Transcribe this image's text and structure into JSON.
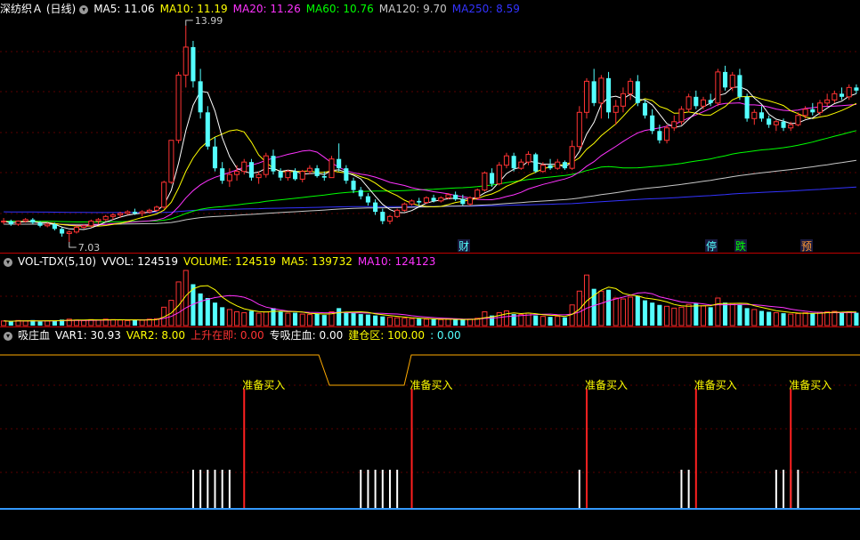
{
  "colors": {
    "up": "#ff3333",
    "down": "#54ffff",
    "ma5": "#ffffff",
    "ma10": "#ffff00",
    "ma20": "#ff33ff",
    "ma60": "#00ff00",
    "ma120": "#c8c8c8",
    "ma250": "#3333ff",
    "grid": "#5a0000",
    "separator": "#c00000"
  },
  "main": {
    "stock_name": "深纺织Ａ (日线)",
    "legend": [
      {
        "text": "MA5: 11.06",
        "color": "#ffffff"
      },
      {
        "text": "MA10: 11.19",
        "color": "#ffff00"
      },
      {
        "text": "MA20: 11.26",
        "color": "#ff33ff"
      },
      {
        "text": "MA60: 10.76",
        "color": "#00ff00"
      },
      {
        "text": "MA120: 9.70",
        "color": "#c8c8c8"
      },
      {
        "text": "MA250: 8.59",
        "color": "#3333ff"
      }
    ],
    "high_label": "13.99",
    "low_label": "7.03",
    "event_marks": [
      {
        "text": "财",
        "color": "#54ffff"
      },
      {
        "text": "停",
        "color": "#54ffff"
      },
      {
        "text": "跌",
        "color": "#00ff00"
      },
      {
        "text": "预",
        "color": "#ff9933"
      }
    ]
  },
  "volume": {
    "indicator": "VOL-TDX(5,10)",
    "legend": [
      {
        "text": "VVOL: 124519",
        "color": "#ffffff"
      },
      {
        "text": "VOLUME: 124519",
        "color": "#ffff00"
      },
      {
        "text": "MA5: 139732",
        "color": "#ffff00"
      },
      {
        "text": "MA10: 124123",
        "color": "#ff33ff"
      }
    ]
  },
  "indicator": {
    "name": "吸庄血",
    "legend": [
      {
        "text": "VAR1: 30.93",
        "color": "#ffffff"
      },
      {
        "text": "VAR2: 8.00",
        "color": "#ffff00"
      },
      {
        "text": "上升在即: 0.00",
        "color": "#ff3333"
      },
      {
        "text": "专吸庄血: 0.00",
        "color": "#ffffff"
      },
      {
        "text": "建仓区: 100.00",
        "color": "#ffff00"
      },
      {
        "text": ": 0.00",
        "color": "#54ffff"
      }
    ],
    "signal_label": "准备买入"
  },
  "chart_data": [
    {
      "type": "candlestick",
      "title": "深纺织Ａ (日线)",
      "price_range": [
        7.03,
        13.99
      ],
      "high": 13.99,
      "low": 7.03,
      "ohlc": [
        [
          7.7,
          7.8,
          7.6,
          7.7
        ],
        [
          7.7,
          7.75,
          7.55,
          7.6
        ],
        [
          7.6,
          7.72,
          7.55,
          7.7
        ],
        [
          7.7,
          7.8,
          7.65,
          7.75
        ],
        [
          7.75,
          7.8,
          7.6,
          7.65
        ],
        [
          7.65,
          7.7,
          7.5,
          7.55
        ],
        [
          7.55,
          7.65,
          7.5,
          7.6
        ],
        [
          7.6,
          7.65,
          7.4,
          7.45
        ],
        [
          7.45,
          7.5,
          7.2,
          7.3
        ],
        [
          7.3,
          7.4,
          7.03,
          7.35
        ],
        [
          7.35,
          7.55,
          7.3,
          7.5
        ],
        [
          7.5,
          7.6,
          7.45,
          7.55
        ],
        [
          7.55,
          7.75,
          7.5,
          7.7
        ],
        [
          7.7,
          7.8,
          7.6,
          7.75
        ],
        [
          7.75,
          7.9,
          7.7,
          7.85
        ],
        [
          7.85,
          7.95,
          7.75,
          7.9
        ],
        [
          7.9,
          8.0,
          7.8,
          7.95
        ],
        [
          7.95,
          8.05,
          7.9,
          8.0
        ],
        [
          8.0,
          8.1,
          7.9,
          7.95
        ],
        [
          7.95,
          8.05,
          7.85,
          8.0
        ],
        [
          8.0,
          8.1,
          7.95,
          8.05
        ],
        [
          8.05,
          8.2,
          8.0,
          8.15
        ],
        [
          8.15,
          9.0,
          8.1,
          8.95
        ],
        [
          8.95,
          10.3,
          8.9,
          10.3
        ],
        [
          10.3,
          12.5,
          10.2,
          12.4
        ],
        [
          12.4,
          13.99,
          12.0,
          13.3
        ],
        [
          13.3,
          13.5,
          12.0,
          12.2
        ],
        [
          12.2,
          12.6,
          11.0,
          11.2
        ],
        [
          11.2,
          11.4,
          10.0,
          10.1
        ],
        [
          10.1,
          10.4,
          9.3,
          9.4
        ],
        [
          9.4,
          9.6,
          8.9,
          9.0
        ],
        [
          9.0,
          9.4,
          8.8,
          9.2
        ],
        [
          9.2,
          9.5,
          9.0,
          9.3
        ],
        [
          9.3,
          9.7,
          9.2,
          9.6
        ],
        [
          9.6,
          9.7,
          9.0,
          9.1
        ],
        [
          9.1,
          9.3,
          8.9,
          9.2
        ],
        [
          9.2,
          9.9,
          9.1,
          9.8
        ],
        [
          9.8,
          10.0,
          9.2,
          9.3
        ],
        [
          9.3,
          9.4,
          9.0,
          9.1
        ],
        [
          9.1,
          9.35,
          9.0,
          9.3
        ],
        [
          9.3,
          9.4,
          9.0,
          9.05
        ],
        [
          9.05,
          9.35,
          8.95,
          9.3
        ],
        [
          9.3,
          9.5,
          9.2,
          9.4
        ],
        [
          9.4,
          9.5,
          9.1,
          9.15
        ],
        [
          9.15,
          9.3,
          9.0,
          9.1
        ],
        [
          9.1,
          9.8,
          9.1,
          9.7
        ],
        [
          9.7,
          10.2,
          9.3,
          9.4
        ],
        [
          9.4,
          9.5,
          8.9,
          9.0
        ],
        [
          9.0,
          9.1,
          8.6,
          8.7
        ],
        [
          8.7,
          8.8,
          8.4,
          8.5
        ],
        [
          8.5,
          8.6,
          8.2,
          8.3
        ],
        [
          8.3,
          8.4,
          7.9,
          8.0
        ],
        [
          8.0,
          8.1,
          7.6,
          7.7
        ],
        [
          7.7,
          7.9,
          7.6,
          7.85
        ],
        [
          7.85,
          8.1,
          7.8,
          8.05
        ],
        [
          8.05,
          8.3,
          8.0,
          8.25
        ],
        [
          8.25,
          8.4,
          8.2,
          8.35
        ],
        [
          8.35,
          8.45,
          8.2,
          8.3
        ],
        [
          8.3,
          8.5,
          8.25,
          8.45
        ],
        [
          8.45,
          8.55,
          8.3,
          8.35
        ],
        [
          8.35,
          8.5,
          8.3,
          8.45
        ],
        [
          8.45,
          8.6,
          8.4,
          8.55
        ],
        [
          8.55,
          8.65,
          8.35,
          8.4
        ],
        [
          8.4,
          8.55,
          8.2,
          8.25
        ],
        [
          8.25,
          8.5,
          8.2,
          8.45
        ],
        [
          8.45,
          8.75,
          8.4,
          8.7
        ],
        [
          8.7,
          9.3,
          8.65,
          9.25
        ],
        [
          9.25,
          9.4,
          8.8,
          8.9
        ],
        [
          8.9,
          9.6,
          8.85,
          9.5
        ],
        [
          9.5,
          9.9,
          9.4,
          9.8
        ],
        [
          9.8,
          9.9,
          9.3,
          9.4
        ],
        [
          9.4,
          9.7,
          9.35,
          9.6
        ],
        [
          9.6,
          9.95,
          9.5,
          9.85
        ],
        [
          9.85,
          9.9,
          9.25,
          9.3
        ],
        [
          9.3,
          9.6,
          9.25,
          9.5
        ],
        [
          9.5,
          9.7,
          9.35,
          9.4
        ],
        [
          9.4,
          9.7,
          9.35,
          9.6
        ],
        [
          9.6,
          9.65,
          9.35,
          9.4
        ],
        [
          9.4,
          10.3,
          9.35,
          10.1
        ],
        [
          10.1,
          11.4,
          10.0,
          11.2
        ],
        [
          11.2,
          12.3,
          11.0,
          12.2
        ],
        [
          12.2,
          12.6,
          11.4,
          11.5
        ],
        [
          11.5,
          12.4,
          11.0,
          12.3
        ],
        [
          12.3,
          12.5,
          11.0,
          11.2
        ],
        [
          11.2,
          11.6,
          10.8,
          11.4
        ],
        [
          11.4,
          12.0,
          11.2,
          11.8
        ],
        [
          11.8,
          12.3,
          11.6,
          12.2
        ],
        [
          12.2,
          12.4,
          11.4,
          11.5
        ],
        [
          11.5,
          11.6,
          11.0,
          11.1
        ],
        [
          11.1,
          11.3,
          10.5,
          10.6
        ],
        [
          10.6,
          10.8,
          10.2,
          10.3
        ],
        [
          10.3,
          10.8,
          10.2,
          10.7
        ],
        [
          10.7,
          11.1,
          10.6,
          10.9
        ],
        [
          10.9,
          11.4,
          10.8,
          11.3
        ],
        [
          11.3,
          11.8,
          11.2,
          11.7
        ],
        [
          11.7,
          11.9,
          11.3,
          11.4
        ],
        [
          11.4,
          11.7,
          11.3,
          11.6
        ],
        [
          11.6,
          11.8,
          11.4,
          11.5
        ],
        [
          11.5,
          12.6,
          11.4,
          12.5
        ],
        [
          12.5,
          12.7,
          11.9,
          12.0
        ],
        [
          12.0,
          12.5,
          11.9,
          12.4
        ],
        [
          12.4,
          12.6,
          11.6,
          11.7
        ],
        [
          11.7,
          11.8,
          10.9,
          11.0
        ],
        [
          11.0,
          11.3,
          10.8,
          11.2
        ],
        [
          11.2,
          11.4,
          10.9,
          11.0
        ],
        [
          11.0,
          11.1,
          10.7,
          10.8
        ],
        [
          10.8,
          10.95,
          10.6,
          10.9
        ],
        [
          10.9,
          11.0,
          10.6,
          10.7
        ],
        [
          10.7,
          10.9,
          10.6,
          10.8
        ],
        [
          10.8,
          11.2,
          10.75,
          11.1
        ],
        [
          11.1,
          11.4,
          11.0,
          11.3
        ],
        [
          11.3,
          11.5,
          11.1,
          11.2
        ],
        [
          11.2,
          11.6,
          11.1,
          11.5
        ],
        [
          11.5,
          11.8,
          11.4,
          11.6
        ],
        [
          11.6,
          11.9,
          11.5,
          11.8
        ],
        [
          11.8,
          12.0,
          11.6,
          11.7
        ],
        [
          11.7,
          12.1,
          11.6,
          12.0
        ],
        [
          12.0,
          12.1,
          11.8,
          11.9
        ]
      ],
      "moving_averages": [
        "MA5",
        "MA10",
        "MA20",
        "MA60",
        "MA120",
        "MA250"
      ]
    },
    {
      "type": "bar",
      "title": "VOL-TDX(5,10)",
      "values": [
        10,
        9,
        11,
        10,
        12,
        9,
        10,
        11,
        13,
        14,
        12,
        11,
        13,
        12,
        14,
        13,
        12,
        11,
        13,
        12,
        14,
        15,
        40,
        55,
        95,
        120,
        90,
        70,
        60,
        50,
        40,
        35,
        30,
        28,
        32,
        27,
        30,
        38,
        30,
        27,
        28,
        25,
        24,
        26,
        23,
        30,
        38,
        30,
        27,
        25,
        24,
        22,
        20,
        18,
        17,
        16,
        15,
        15,
        14,
        14,
        13,
        14,
        13,
        13,
        14,
        16,
        30,
        22,
        28,
        32,
        25,
        24,
        27,
        22,
        20,
        19,
        20,
        18,
        45,
        75,
        110,
        80,
        75,
        78,
        60,
        58,
        62,
        65,
        55,
        50,
        45,
        42,
        38,
        40,
        46,
        48,
        43,
        40,
        60,
        50,
        48,
        45,
        38,
        35,
        32,
        30,
        28,
        27,
        25,
        26,
        28,
        27,
        29,
        30,
        31,
        29,
        30,
        28
      ],
      "ma_series": [
        "MA5",
        "MA10"
      ]
    },
    {
      "type": "signal",
      "title": "吸庄血",
      "signal_label": "准备买入",
      "buy_signal_bars": [
        33,
        56,
        80,
        95,
        108
      ],
      "white_spike_bars": [
        26,
        27,
        28,
        29,
        30,
        31,
        49,
        50,
        51,
        52,
        53,
        54,
        79,
        93,
        94,
        106,
        107,
        108,
        109
      ]
    }
  ]
}
